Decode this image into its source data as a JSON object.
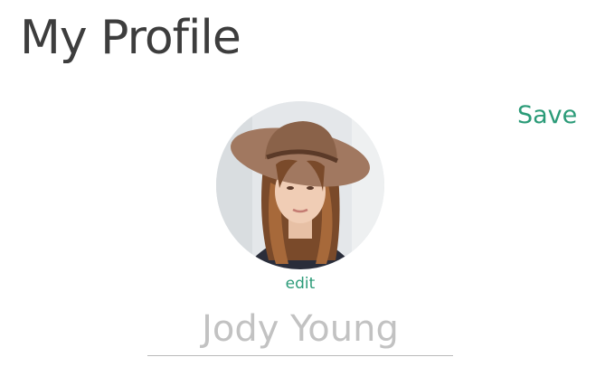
{
  "header": {
    "title": "My Profile",
    "save_label": "Save"
  },
  "profile": {
    "edit_label": "edit",
    "name_value": "Jody Young"
  },
  "colors": {
    "accent": "#2b9b78",
    "title": "#3d3d3d",
    "muted_text": "#c2c2c2",
    "underline": "#b9b9b9",
    "background": "#ffffff"
  }
}
